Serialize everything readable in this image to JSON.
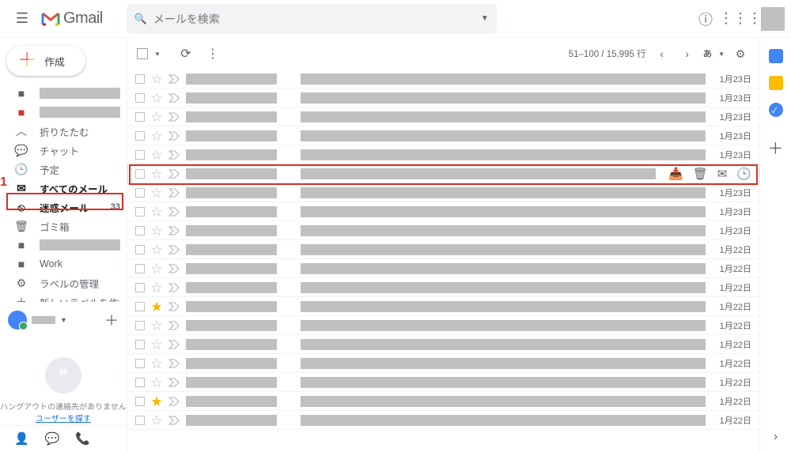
{
  "header": {
    "logo_text": "Gmail",
    "search_placeholder": "メールを検索"
  },
  "compose_label": "作成",
  "sidebar": {
    "items": [
      {
        "icon": "label-gray",
        "label": "",
        "masked": true
      },
      {
        "icon": "label-red",
        "label": "",
        "masked": true
      },
      {
        "icon": "collapse",
        "label": "折りたたむ"
      },
      {
        "icon": "chat",
        "label": "チャット"
      },
      {
        "icon": "schedule",
        "label": "予定"
      },
      {
        "icon": "all",
        "label": "すべてのメール",
        "selected": true
      },
      {
        "icon": "spam",
        "label": "迷惑メール",
        "bold": true,
        "count": "33"
      },
      {
        "icon": "trash",
        "label": "ゴミ箱"
      },
      {
        "icon": "label-gray",
        "label": "",
        "masked": true
      },
      {
        "icon": "label-gray",
        "label": "Work"
      },
      {
        "icon": "gear",
        "label": "ラベルの管理"
      },
      {
        "icon": "plus",
        "label": "新しいラベルを作成"
      }
    ]
  },
  "hangout": {
    "empty_text": "ハングアウトの連絡先がありません",
    "link_text": "ユーザーを探す"
  },
  "toolbar": {
    "pager": "51–100 / 15,995 行",
    "ime": "あ"
  },
  "rows": [
    {
      "date": "1月23日",
      "star": false
    },
    {
      "date": "1月23日",
      "star": false
    },
    {
      "date": "1月23日",
      "star": false
    },
    {
      "date": "1月23日",
      "star": false
    },
    {
      "date": "1月23日",
      "star": false
    },
    {
      "date": "",
      "star": false,
      "hover": true
    },
    {
      "date": "1月23日",
      "star": false
    },
    {
      "date": "1月23日",
      "star": false
    },
    {
      "date": "1月23日",
      "star": false
    },
    {
      "date": "1月22日",
      "star": false
    },
    {
      "date": "1月22日",
      "star": false
    },
    {
      "date": "1月22日",
      "star": false
    },
    {
      "date": "1月22日",
      "star": true
    },
    {
      "date": "1月22日",
      "star": false
    },
    {
      "date": "1月22日",
      "star": false
    },
    {
      "date": "1月22日",
      "star": false
    },
    {
      "date": "1月22日",
      "star": false
    },
    {
      "date": "1月22日",
      "star": true
    },
    {
      "date": "1月22日",
      "star": false
    }
  ],
  "annotation": {
    "num": "1"
  }
}
